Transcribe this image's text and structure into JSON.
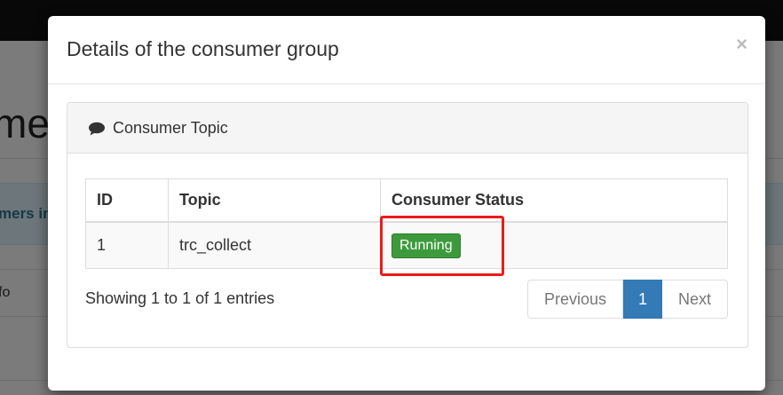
{
  "background": {
    "title_fragment": "mer",
    "alert_fragment": "mers in",
    "info_fragment": "fo"
  },
  "modal": {
    "title": "Details of the consumer group",
    "close_label": "×",
    "panel": {
      "title": "Consumer Topic",
      "icon": "comment-icon"
    },
    "table": {
      "headers": [
        "ID",
        "Topic",
        "Consumer Status"
      ],
      "rows": [
        {
          "id": "1",
          "topic": "trc_collect",
          "status": "Running"
        }
      ]
    },
    "info": "Showing 1 to 1 of 1 entries",
    "pagination": {
      "previous": "Previous",
      "current": "1",
      "next": "Next"
    }
  },
  "colors": {
    "status_running": "#3c9a3c",
    "pagination_active": "#337ab7",
    "highlight": "#e81c1c"
  }
}
